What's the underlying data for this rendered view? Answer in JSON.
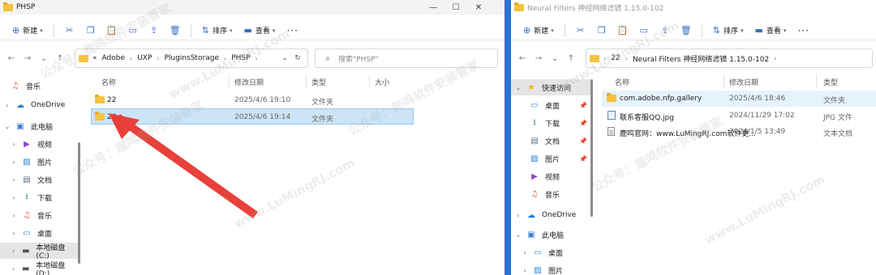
{
  "left": {
    "title": "PHSP",
    "toolbar": {
      "new": "新建",
      "sort": "排序",
      "view": "查看",
      "more": "···"
    },
    "breadcrumb": [
      "«",
      "Adobe",
      "UXP",
      "PluginsStorage",
      "PHSP"
    ],
    "search_placeholder": "搜索\"PHSP\"",
    "sidebar": [
      {
        "label": "音乐",
        "icon": "music-icon"
      },
      {
        "label": "OneDrive",
        "icon": "cloud-icon"
      },
      {
        "label": "此电脑",
        "icon": "computer-icon"
      },
      {
        "label": "视频",
        "icon": "video-icon"
      },
      {
        "label": "图片",
        "icon": "picture-icon"
      },
      {
        "label": "文档",
        "icon": "document-icon"
      },
      {
        "label": "下载",
        "icon": "download-icon"
      },
      {
        "label": "音乐",
        "icon": "music-icon"
      },
      {
        "label": "桌面",
        "icon": "desktop-icon"
      },
      {
        "label": "本地磁盘 (C:)",
        "icon": "drive-icon"
      },
      {
        "label": "本地磁盘 (D:)",
        "icon": "drive-icon"
      }
    ],
    "columns": [
      "名称",
      "修改日期",
      "类型",
      "大小"
    ],
    "rows": [
      {
        "name": "22",
        "date": "2025/4/6 19:10",
        "type": "文件夹"
      },
      {
        "name": "26",
        "date": "2025/4/6 19:14",
        "type": "文件夹"
      }
    ]
  },
  "right": {
    "title": "Neural Filters 神经网络滤镜 1.15.0-102",
    "toolbar": {
      "new": "新建",
      "sort": "排序",
      "view": "查看",
      "more": "···"
    },
    "breadcrumb": [
      "22",
      "Neural Filters 神经网络滤镜 1.15.0-102"
    ],
    "sidebar": [
      {
        "label": "快速访问",
        "icon": "star-icon"
      },
      {
        "label": "桌面",
        "icon": "desktop-icon"
      },
      {
        "label": "下载",
        "icon": "download-icon"
      },
      {
        "label": "文档",
        "icon": "document-icon"
      },
      {
        "label": "图片",
        "icon": "picture-icon"
      },
      {
        "label": "视频",
        "icon": "video-icon"
      },
      {
        "label": "音乐",
        "icon": "music-icon"
      },
      {
        "label": "OneDrive",
        "icon": "cloud-icon"
      },
      {
        "label": "此电脑",
        "icon": "computer-icon"
      },
      {
        "label": "桌面",
        "icon": "desktop-icon"
      },
      {
        "label": "图片",
        "icon": "picture-icon"
      }
    ],
    "columns": [
      "名称",
      "修改日期",
      "类型"
    ],
    "rows": [
      {
        "name": "com.adobe.nfp.gallery",
        "date": "2025/4/6 18:46",
        "type": "文件夹"
      },
      {
        "name": "联系客服QQ.jpg",
        "date": "2024/11/29 17:02",
        "type": "JPG 文件"
      },
      {
        "name": "鹿鸣官网：www.LuMingRJ.com软件更...",
        "date": "2024/1/5 13:49",
        "type": "文本文档"
      }
    ]
  },
  "watermarks": [
    "www.LuMingRJ.com",
    "公众号：鹿鸣软件安装管家"
  ],
  "colors": {
    "accent": "#2f6fd6",
    "selection": "#cce4f7",
    "arrow": "#e8403a",
    "folder": "#f7c23e"
  }
}
